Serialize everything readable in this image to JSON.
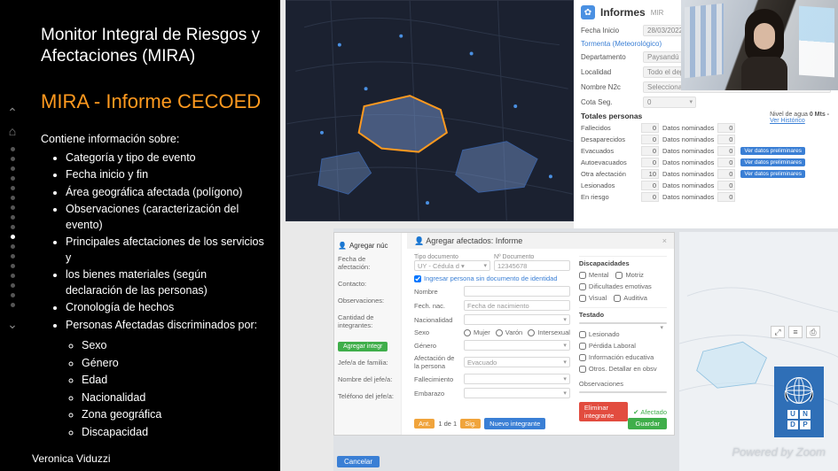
{
  "slide": {
    "title": "Monitor Integral de Riesgos y Afectaciones (MIRA)",
    "subtitle": "MIRA - Informe CECOED",
    "intro": "Contiene información sobre:",
    "bullets": [
      "Categoría y tipo de evento",
      "Fecha inicio y fin",
      "Área geográfica afectada (polígono)",
      "Observaciones (caracterización del evento)",
      "Principales afectaciones de los servicios y",
      "los bienes materiales (según declaración de las personas)",
      "Cronología de hechos",
      "Personas Afectadas discriminados por:"
    ],
    "sub_bullets": [
      "Sexo",
      "Género",
      "Edad",
      "Nacionalidad",
      "Zona geográfica",
      "Discapacidad"
    ]
  },
  "speaker_name": "Veronica Viduzzi",
  "map": {
    "zoom_in": "+",
    "zoom_out": "−"
  },
  "informes": {
    "title": "Informes",
    "title_note": "MIR",
    "fields": {
      "fecha_inicio_lbl": "Fecha Inicio",
      "fecha_inicio_val": "28/03/2022 10:03",
      "tipo_lbl": "Tormenta (Meteorológico)",
      "departamento_lbl": "Departamento",
      "departamento_val": "Paysandú",
      "localidad_lbl": "Localidad",
      "localidad_val": "Todo el departamento",
      "hombre_lbl": "Nombre N2c",
      "hombre_val": "Seleccionar N2c",
      "cota_lbl": "Cota Seg.",
      "cota_val": "0"
    },
    "nivel": {
      "lbl": "Nivel de agua",
      "val": "0 Mts -",
      "link": "Ver Histórico"
    },
    "section": "Totales personas",
    "stats": [
      {
        "lbl": "Fallecidos",
        "num": "0",
        "txt": "Datos nominados",
        "num2": "0",
        "btn": ""
      },
      {
        "lbl": "Desaparecidos",
        "num": "0",
        "txt": "Datos nominados",
        "num2": "0",
        "btn": ""
      },
      {
        "lbl": "Evacuados",
        "num": "0",
        "txt": "Datos nominados",
        "num2": "0",
        "btn": "Ver datos preliminares"
      },
      {
        "lbl": "Autoevacuados",
        "num": "0",
        "txt": "Datos nominados",
        "num2": "0",
        "btn": "Ver datos preliminares"
      },
      {
        "lbl": "Otra afectación",
        "num": "10",
        "txt": "Datos nominados",
        "num2": "0",
        "btn": "Ver datos preliminares"
      },
      {
        "lbl": "Lesionados",
        "num": "0",
        "txt": "Datos nominados",
        "num2": "0",
        "btn": ""
      },
      {
        "lbl": "En riesgo",
        "num": "0",
        "txt": "Datos nominados",
        "num2": "0",
        "btn": ""
      }
    ]
  },
  "toolicons": {
    "a": "⤢",
    "b": "≡",
    "c": "⎙"
  },
  "form": {
    "side": {
      "header_left": "Agregar núc",
      "lbl1": "Fecha de afectación:",
      "lbl2": "Contacto:",
      "lbl3": "Observaciones:",
      "lbl4": "Cantidad de integrantes:",
      "btn_add": "Agregar integr",
      "lbl5": "Jefe/a de familia:",
      "lbl6": "Nombre del jefe/a:",
      "lbl7": "Teléfono del jefe/a:"
    },
    "modal": {
      "title": "Agregar afectados: Informe",
      "tipo_doc_lbl": "Tipo documento",
      "tipo_doc_val": "UY - Cédula d ▾",
      "num_doc_lbl": "Nº Documento",
      "num_doc_val": "12345678",
      "sin_doc": "Ingresar persona sin documento de identidad",
      "nombre_lbl": "Nombre",
      "nombre_ph": "Nombre",
      "fnac_lbl": "Fech. nac.",
      "fnac_ph": "Fecha de nacimiento",
      "nac_lbl": "Nacionalidad",
      "sexo_lbl": "Sexo",
      "sexo_opts": [
        "Mujer",
        "Varón",
        "Intersexual"
      ],
      "genero_lbl": "Género",
      "afect_lbl": "Afectación de la persona",
      "afect_val": "Evacuado",
      "fall_lbl": "Fallecimiento",
      "emb_lbl": "Embarazo",
      "disc_hdr": "Discapacidades",
      "disc_opts": [
        "Mental",
        "Motriz",
        "Dificultades emotivas",
        "Visual",
        "Auditiva"
      ],
      "testado_hdr": "Testado",
      "test_opts": [
        "Lesionado",
        "Pérdida Laboral",
        "Información educativa",
        "Otros. Detallar en obsv"
      ],
      "obs_lbl": "Observaciones",
      "btn_del": "Eliminar integrante",
      "btn_ok": "Afectado",
      "pager_prev": "Ant.",
      "pager_txt": "1 de 1",
      "pager_next": "Sig.",
      "btn_new": "Nuevo integrante",
      "btn_save": "Guardar"
    },
    "cancel": "Cancelar"
  },
  "undp": {
    "letters": [
      "U",
      "N",
      "D",
      "P"
    ]
  },
  "powered": "Powered by Zoom"
}
